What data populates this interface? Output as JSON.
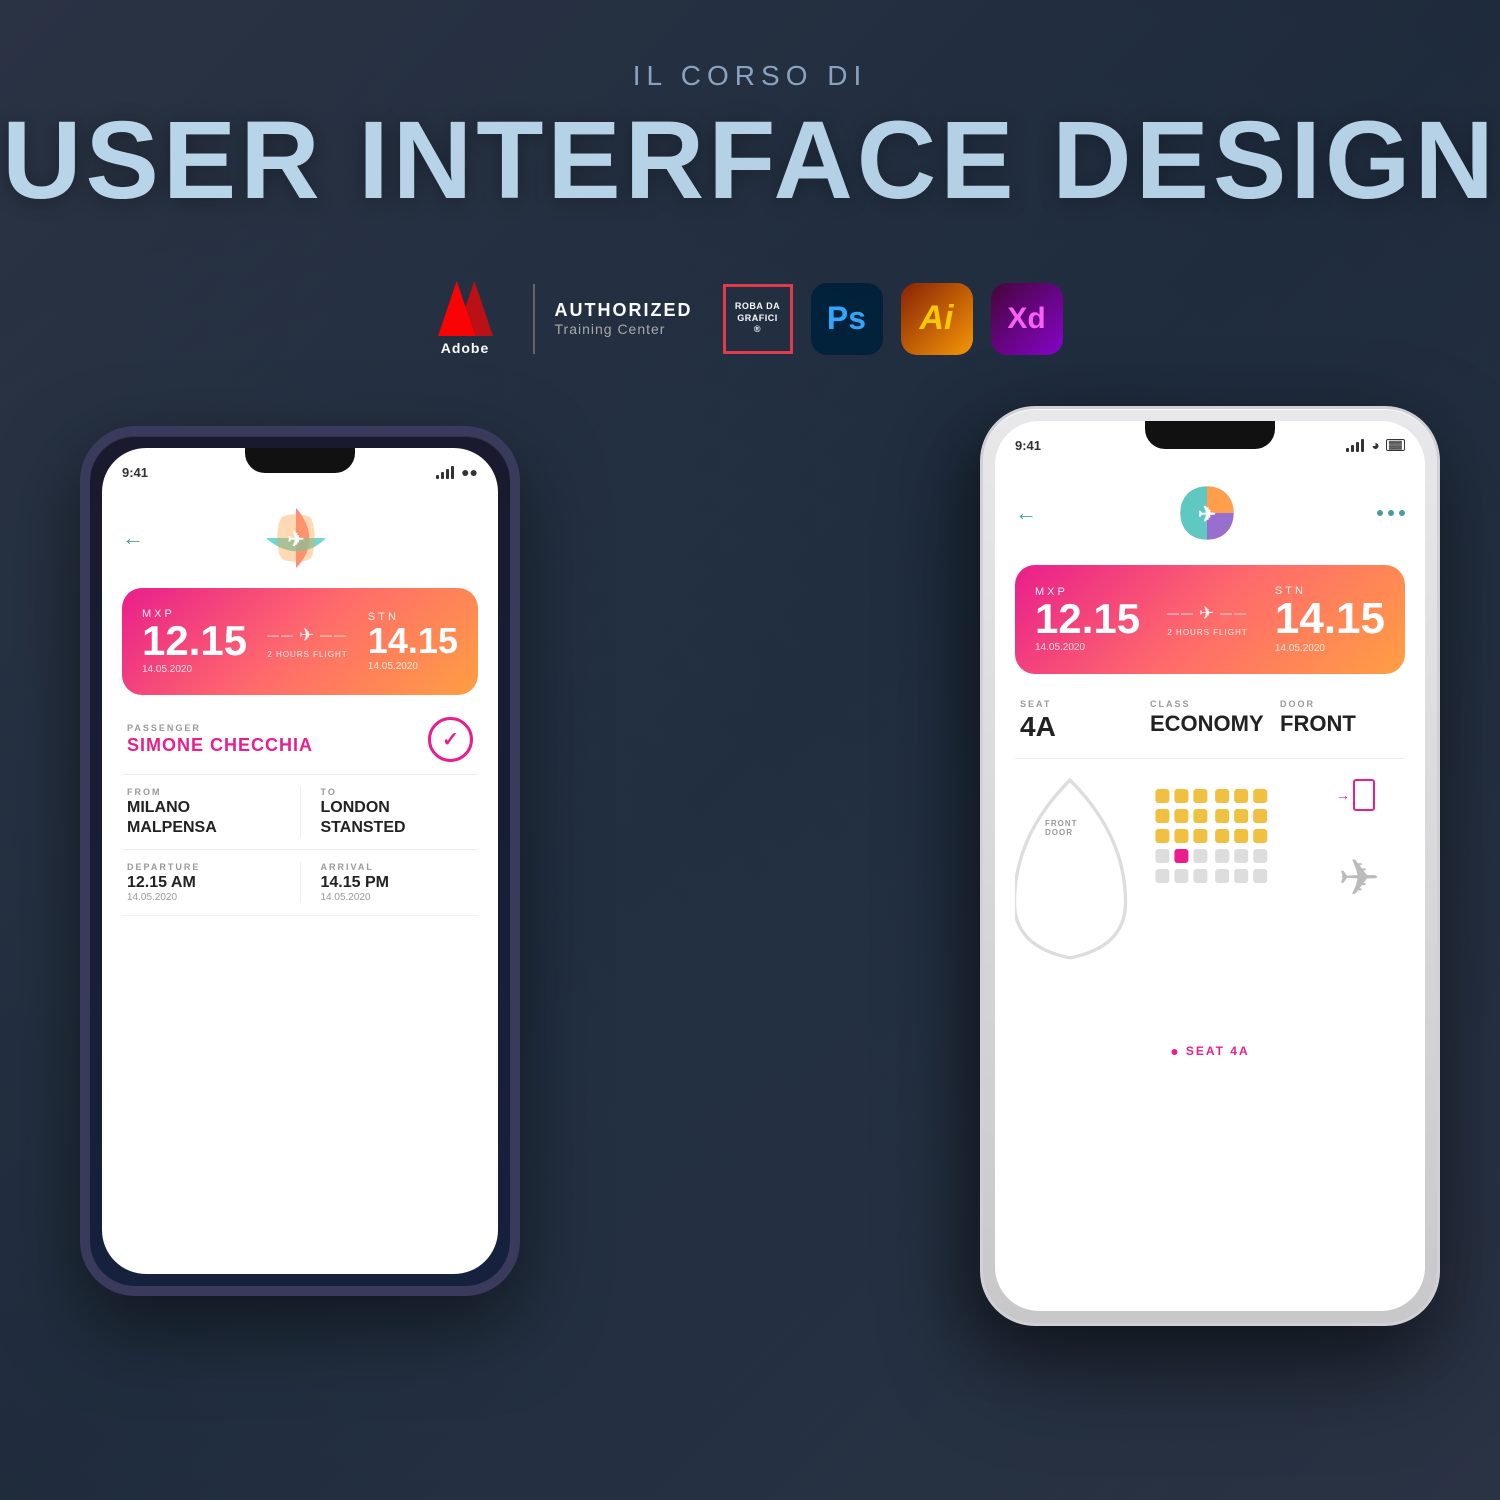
{
  "header": {
    "subtitle": "IL CORSO DI",
    "main_title": "USER INTERFACE DESIGN"
  },
  "logos": {
    "adobe_text": "Adobe",
    "authorized_line1": "AUTHORIZED",
    "authorized_line2": "Training Center",
    "roba_line1": "ROBA DA",
    "roba_line2": "GRAFICI",
    "roba_line3": "®",
    "ps_label": "Ps",
    "ai_label": "Ai",
    "xd_label": "Xd"
  },
  "phone_back": {
    "status_time": "9:41",
    "flight_from_code": "MXP",
    "flight_to_code": "STN",
    "flight_from_time": "12.15",
    "flight_to_time": "14.15",
    "flight_date_from": "14.05.2020",
    "flight_duration": "2 HOURS FLIGHT",
    "flight_date_to": "14.05.2020",
    "passenger_label": "PASSENGER",
    "passenger_name": "SIMONE CHECCHIA",
    "from_label": "FROM",
    "from_city": "MILANO",
    "from_airport": "MALPENSA",
    "to_label": "TO",
    "to_city": "LONDON",
    "to_airport": "STANSTED",
    "departure_label": "DEPARTURE",
    "departure_time": "12.15 AM",
    "departure_date": "14.05.2020",
    "arrival_label": "ARRIVAL",
    "arrival_time": "14.15 PM",
    "arrival_date": "14.05.2020"
  },
  "phone_front": {
    "status_time": "9:41",
    "flight_from_code": "MXP",
    "flight_to_code": "STN",
    "flight_from_time": "12.15",
    "flight_to_time": "14.15",
    "flight_date_from": "14.05.2020",
    "flight_duration": "2 HOURS FLIGHT",
    "flight_date_to": "14.05.2020",
    "seat_label": "SEAT",
    "seat_value": "4A",
    "class_label": "CLASS",
    "class_value": "ECONOMY",
    "door_label": "DOOR",
    "door_value": "FRONT",
    "front_door_label": "FRONT\nDOOR",
    "seat_4a_label": "SEAT 4A"
  }
}
